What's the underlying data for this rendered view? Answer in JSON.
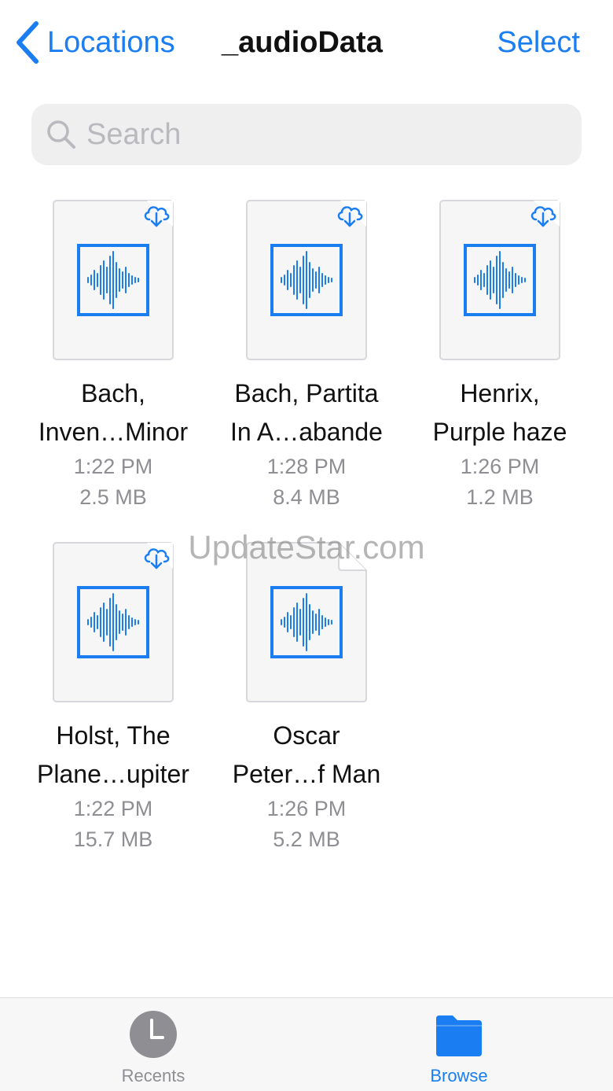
{
  "nav": {
    "back_label": "Locations",
    "title": "_audioData",
    "select_label": "Select"
  },
  "search": {
    "placeholder": "Search"
  },
  "files": [
    {
      "line1": "Bach,",
      "line2": "Inven…Minor",
      "time": "1:22 PM",
      "size": "2.5 MB",
      "icon": "cloud-download-icon"
    },
    {
      "line1": "Bach, Partita",
      "line2": "In A…abande",
      "time": "1:28 PM",
      "size": "8.4 MB",
      "icon": "cloud-download-icon"
    },
    {
      "line1": "Henrix,",
      "line2": "Purple haze",
      "time": "1:26 PM",
      "size": "1.2 MB",
      "icon": "cloud-download-icon"
    },
    {
      "line1": "Holst, The",
      "line2": "Plane…upiter",
      "time": "1:22 PM",
      "size": "15.7 MB",
      "icon": "cloud-download-icon"
    },
    {
      "line1": "Oscar",
      "line2": "Peter…f Man",
      "time": "1:26 PM",
      "size": "5.2 MB",
      "icon": null
    }
  ],
  "watermark": "UpdateStar.com",
  "tabbar": {
    "recents_label": "Recents",
    "browse_label": "Browse"
  },
  "colors": {
    "accent": "#1a7df2",
    "inactive": "#8e8e93",
    "waveform": "#1a7df2"
  }
}
